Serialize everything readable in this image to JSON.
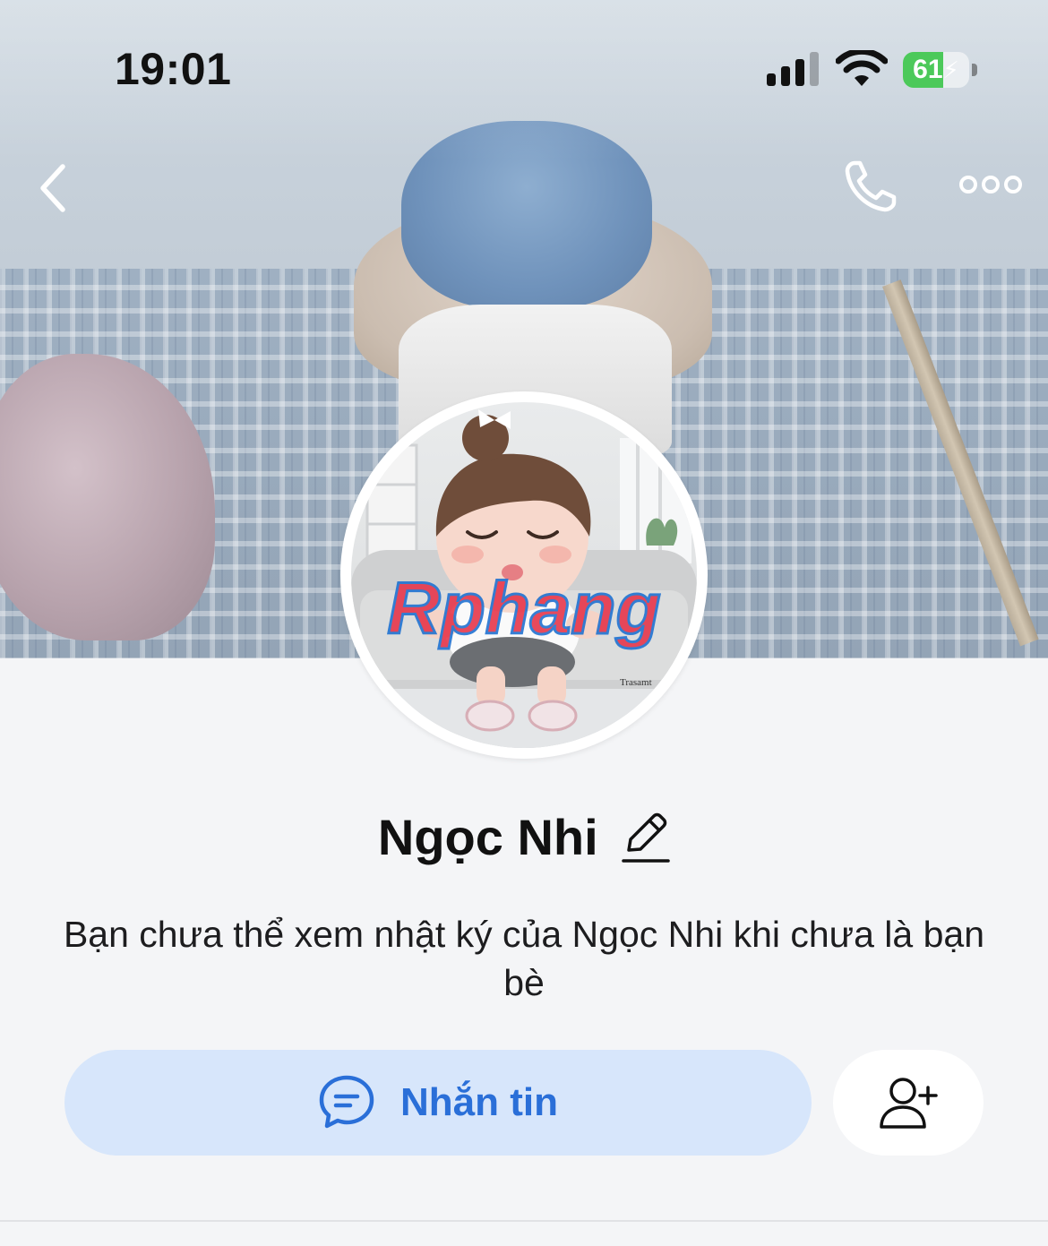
{
  "status_bar": {
    "time": "19:01",
    "battery_level": "61",
    "battery_fraction": 0.61,
    "icons": [
      "signal-icon",
      "wifi-icon",
      "battery-charging-icon"
    ]
  },
  "nav": {
    "back_icon": "chevron-left-icon",
    "call_icon": "phone-icon",
    "more_icon": "more-horizontal-icon"
  },
  "avatar": {
    "watermark": "Rphang",
    "caption": "Trasamt"
  },
  "profile": {
    "name": "Ngọc Nhi",
    "edit_icon": "pencil-icon",
    "notice": "Bạn chưa thể xem nhật ký của Ngọc Nhi khi chưa là bạn bè"
  },
  "actions": {
    "message_label": "Nhắn tin",
    "message_icon": "chat-bubble-icon",
    "add_friend_icon": "add-friend-icon"
  },
  "colors": {
    "accent": "#2a6fd8",
    "message_button_bg": "#d7e6fb",
    "page_bg": "#f4f5f7",
    "battery": "#4cc95a"
  }
}
